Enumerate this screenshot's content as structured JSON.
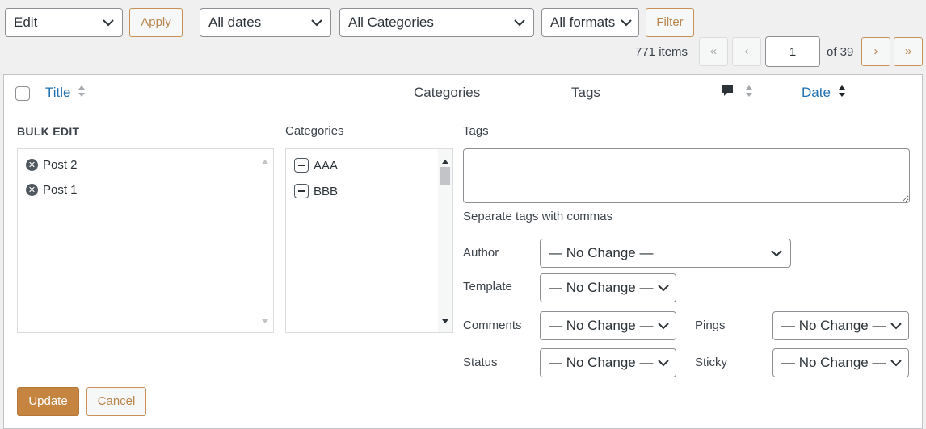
{
  "toolbar": {
    "bulk_action": "Edit",
    "apply_label": "Apply",
    "dates_filter": "All dates",
    "categories_filter": "All Categories",
    "formats_filter": "All formats",
    "filter_label": "Filter"
  },
  "pagination": {
    "items_count": "771 items",
    "first": "«",
    "prev": "‹",
    "current_page": "1",
    "of_pages": "of 39",
    "next": "›",
    "last": "»"
  },
  "columns": {
    "title": "Title",
    "categories": "Categories",
    "tags": "Tags",
    "date": "Date"
  },
  "bulk_edit": {
    "heading": "BULK EDIT",
    "posts": [
      "Post 2",
      "Post 1"
    ],
    "categories_label": "Categories",
    "categories": [
      "AAA",
      "BBB"
    ],
    "tags_label": "Tags",
    "tags_value": "",
    "tags_hint": "Separate tags with commas",
    "author_label": "Author",
    "author_value": "— No Change —",
    "template_label": "Template",
    "template_value": "— No Change —",
    "comments_label": "Comments",
    "comments_value": "— No Change —",
    "pings_label": "Pings",
    "pings_value": "— No Change —",
    "status_label": "Status",
    "status_value": "— No Change —",
    "sticky_label": "Sticky",
    "sticky_value": "— No Change —",
    "update_label": "Update",
    "cancel_label": "Cancel"
  },
  "colors": {
    "accent": "#c5843f",
    "link": "#2271b1",
    "border": "#8c8f94"
  }
}
